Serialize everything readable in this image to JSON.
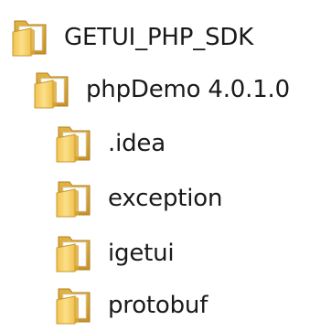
{
  "tree": {
    "items": [
      {
        "label": "GETUI_PHP_SDK",
        "icon": "folder-icon"
      },
      {
        "label": "phpDemo 4.0.1.0",
        "icon": "folder-icon"
      },
      {
        "label": ".idea",
        "icon": "folder-icon"
      },
      {
        "label": "exception",
        "icon": "folder-icon"
      },
      {
        "label": "igetui",
        "icon": "folder-icon"
      },
      {
        "label": "protobuf",
        "icon": "folder-icon"
      }
    ]
  },
  "colors": {
    "folder_back": "#d9a531",
    "folder_front": "#f5d36b",
    "folder_page": "#ffffff",
    "text": "#1a1a1a"
  }
}
